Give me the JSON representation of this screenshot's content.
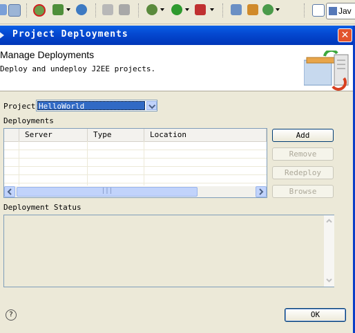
{
  "toolbar": {
    "perspective_label": "Jav"
  },
  "dialog": {
    "title": "Project Deployments",
    "header_title": "Manage Deployments",
    "header_description": "Deploy and undeploy J2EE projects.",
    "project_label": "Project",
    "project_value": "HelloWorld",
    "deployments_label": "Deployments",
    "columns": [
      "Server",
      "Type",
      "Location"
    ],
    "buttons": {
      "add": "Add",
      "remove": "Remove",
      "redeploy": "Redeploy",
      "browse": "Browse"
    },
    "status_label": "Deployment Status",
    "ok_label": "OK",
    "help_glyph": "?"
  },
  "colors": {
    "titlebar": "#0a5fe6",
    "selection": "#316ac5",
    "close": "#e2532d"
  },
  "icons": [
    "refresh-icon",
    "run-icon",
    "debug-icon",
    "globe-icon",
    "help-icon",
    "close-icon",
    "deploy-banner-icon"
  ]
}
